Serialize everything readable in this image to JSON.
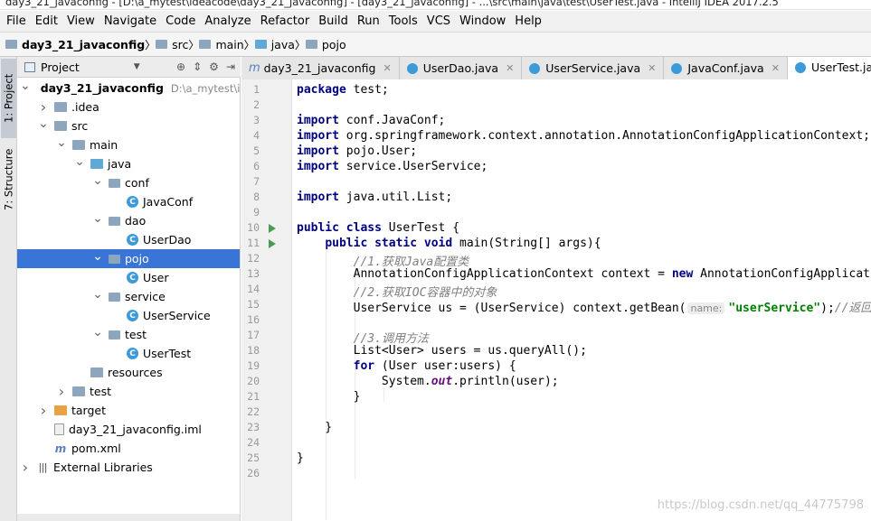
{
  "window": {
    "title": "day3_21_javaconfig - [D:\\a_mytest\\ideacode\\day3_21_javaconfig] - [day3_21_javaconfig] - ...\\src\\main\\java\\test\\UserTest.java - IntelliJ IDEA 2017.2.5"
  },
  "menu": [
    "File",
    "Edit",
    "View",
    "Navigate",
    "Code",
    "Analyze",
    "Refactor",
    "Build",
    "Run",
    "Tools",
    "VCS",
    "Window",
    "Help"
  ],
  "breadcrumb": [
    "day3_21_javaconfig",
    "src",
    "main",
    "java",
    "pojo"
  ],
  "side_tabs": {
    "project": "1: Project",
    "structure": "7: Structure"
  },
  "project_panel": {
    "title": "Project"
  },
  "tree": [
    {
      "label": "day3_21_javaconfig",
      "path": "D:\\a_mytest\\ide",
      "indent": 0,
      "arrow": "▼",
      "icon": "fold",
      "bold": true
    },
    {
      "label": ".idea",
      "indent": 1,
      "arrow": "▶",
      "icon": "fold"
    },
    {
      "label": "src",
      "indent": 1,
      "arrow": "▼",
      "icon": "fold"
    },
    {
      "label": "main",
      "indent": 2,
      "arrow": "▼",
      "icon": "fold"
    },
    {
      "label": "java",
      "indent": 3,
      "arrow": "▼",
      "icon": "fold-blue"
    },
    {
      "label": "conf",
      "indent": 4,
      "arrow": "▼",
      "icon": "pkg"
    },
    {
      "label": "JavaConf",
      "indent": 5,
      "arrow": "",
      "icon": "cls"
    },
    {
      "label": "dao",
      "indent": 4,
      "arrow": "▼",
      "icon": "pkg"
    },
    {
      "label": "UserDao",
      "indent": 5,
      "arrow": "",
      "icon": "cls"
    },
    {
      "label": "pojo",
      "indent": 4,
      "arrow": "▼",
      "icon": "pkg",
      "selected": true
    },
    {
      "label": "User",
      "indent": 5,
      "arrow": "",
      "icon": "cls"
    },
    {
      "label": "service",
      "indent": 4,
      "arrow": "▼",
      "icon": "pkg"
    },
    {
      "label": "UserService",
      "indent": 5,
      "arrow": "",
      "icon": "cls"
    },
    {
      "label": "test",
      "indent": 4,
      "arrow": "▼",
      "icon": "pkg"
    },
    {
      "label": "UserTest",
      "indent": 5,
      "arrow": "",
      "icon": "cls"
    },
    {
      "label": "resources",
      "indent": 3,
      "arrow": "",
      "icon": "fold"
    },
    {
      "label": "test",
      "indent": 2,
      "arrow": "▶",
      "icon": "fold"
    },
    {
      "label": "target",
      "indent": 1,
      "arrow": "▶",
      "icon": "fold-orange"
    },
    {
      "label": "day3_21_javaconfig.iml",
      "indent": 1,
      "arrow": "",
      "icon": "file"
    },
    {
      "label": "pom.xml",
      "indent": 1,
      "arrow": "",
      "icon": "mvn"
    },
    {
      "label": "External Libraries",
      "indent": 0,
      "arrow": "▶",
      "icon": "lib"
    }
  ],
  "editor_tabs": [
    {
      "label": "day3_21_javaconfig",
      "kind": "maven"
    },
    {
      "label": "UserDao.java",
      "kind": "class"
    },
    {
      "label": "UserService.java",
      "kind": "class"
    },
    {
      "label": "JavaConf.java",
      "kind": "class"
    },
    {
      "label": "UserTest.java",
      "kind": "class",
      "active": true
    }
  ],
  "code_lines": [
    [
      {
        "t": "kw",
        "v": "package"
      },
      {
        "t": "",
        "v": " test;"
      }
    ],
    [],
    [
      {
        "t": "kw",
        "v": "import"
      },
      {
        "t": "",
        "v": " conf.JavaConf;"
      }
    ],
    [
      {
        "t": "kw",
        "v": "import"
      },
      {
        "t": "",
        "v": " org.springframework.context.annotation.AnnotationConfigApplicationContext;"
      }
    ],
    [
      {
        "t": "kw",
        "v": "import"
      },
      {
        "t": "",
        "v": " pojo.User;"
      }
    ],
    [
      {
        "t": "kw",
        "v": "import"
      },
      {
        "t": "",
        "v": " service.UserService;"
      }
    ],
    [],
    [
      {
        "t": "kw",
        "v": "import"
      },
      {
        "t": "",
        "v": " java.util.List;"
      }
    ],
    [],
    [
      {
        "t": "kw",
        "v": "public class"
      },
      {
        "t": "",
        "v": " UserTest {"
      }
    ],
    [
      {
        "t": "",
        "v": "    "
      },
      {
        "t": "kw",
        "v": "public static void"
      },
      {
        "t": "",
        "v": " main(String[] args){"
      }
    ],
    [
      {
        "t": "",
        "v": "        "
      },
      {
        "t": "cm",
        "v": "//1.获取Java配置类"
      }
    ],
    [
      {
        "t": "",
        "v": "        AnnotationConfigApplicationContext context = "
      },
      {
        "t": "kw",
        "v": "new"
      },
      {
        "t": "",
        "v": " AnnotationConfigApplicationContext(JavaConf.class);"
      }
    ],
    [
      {
        "t": "",
        "v": "        "
      },
      {
        "t": "cm",
        "v": "//2.获取IOC容器中的对象"
      }
    ],
    [
      {
        "t": "",
        "v": "        UserService us = (UserService) context.getBean("
      },
      {
        "t": "hint",
        "v": "name:"
      },
      {
        "t": "st",
        "v": "\"userService\""
      },
      {
        "t": "",
        "v": ");"
      },
      {
        "t": "cm",
        "v": "//返回"
      }
    ],
    [],
    [
      {
        "t": "",
        "v": "        "
      },
      {
        "t": "cm",
        "v": "//3.调用方法"
      }
    ],
    [
      {
        "t": "",
        "v": "        List<User> users = us.queryAll();"
      }
    ],
    [
      {
        "t": "",
        "v": "        "
      },
      {
        "t": "kw",
        "v": "for"
      },
      {
        "t": "",
        "v": " (User user:users) {"
      }
    ],
    [
      {
        "t": "",
        "v": "            System."
      },
      {
        "t": "fld",
        "v": "out"
      },
      {
        "t": "",
        "v": ".println(user);"
      }
    ],
    [
      {
        "t": "",
        "v": "        }"
      }
    ],
    [],
    [
      {
        "t": "",
        "v": "    }"
      }
    ],
    [],
    [
      {
        "t": "",
        "v": "}"
      }
    ],
    []
  ],
  "run_markers": [
    10,
    11
  ],
  "watermark": "https://blog.csdn.net/qq_44775798",
  "colors": {
    "selection": "#3875d7",
    "current_line": "#fffae3",
    "keyword": "#000080",
    "comment": "#808080",
    "string": "#008000"
  }
}
